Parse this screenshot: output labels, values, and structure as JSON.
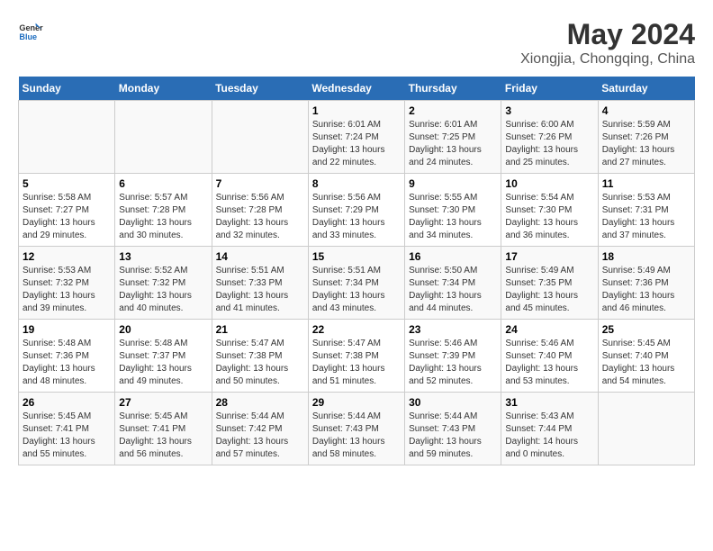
{
  "header": {
    "logo_line1": "General",
    "logo_line2": "Blue",
    "main_title": "May 2024",
    "subtitle": "Xiongjia, Chongqing, China"
  },
  "weekdays": [
    "Sunday",
    "Monday",
    "Tuesday",
    "Wednesday",
    "Thursday",
    "Friday",
    "Saturday"
  ],
  "weeks": [
    [
      {
        "day": "",
        "info": ""
      },
      {
        "day": "",
        "info": ""
      },
      {
        "day": "",
        "info": ""
      },
      {
        "day": "1",
        "info": "Sunrise: 6:01 AM\nSunset: 7:24 PM\nDaylight: 13 hours\nand 22 minutes."
      },
      {
        "day": "2",
        "info": "Sunrise: 6:01 AM\nSunset: 7:25 PM\nDaylight: 13 hours\nand 24 minutes."
      },
      {
        "day": "3",
        "info": "Sunrise: 6:00 AM\nSunset: 7:26 PM\nDaylight: 13 hours\nand 25 minutes."
      },
      {
        "day": "4",
        "info": "Sunrise: 5:59 AM\nSunset: 7:26 PM\nDaylight: 13 hours\nand 27 minutes."
      }
    ],
    [
      {
        "day": "5",
        "info": "Sunrise: 5:58 AM\nSunset: 7:27 PM\nDaylight: 13 hours\nand 29 minutes."
      },
      {
        "day": "6",
        "info": "Sunrise: 5:57 AM\nSunset: 7:28 PM\nDaylight: 13 hours\nand 30 minutes."
      },
      {
        "day": "7",
        "info": "Sunrise: 5:56 AM\nSunset: 7:28 PM\nDaylight: 13 hours\nand 32 minutes."
      },
      {
        "day": "8",
        "info": "Sunrise: 5:56 AM\nSunset: 7:29 PM\nDaylight: 13 hours\nand 33 minutes."
      },
      {
        "day": "9",
        "info": "Sunrise: 5:55 AM\nSunset: 7:30 PM\nDaylight: 13 hours\nand 34 minutes."
      },
      {
        "day": "10",
        "info": "Sunrise: 5:54 AM\nSunset: 7:30 PM\nDaylight: 13 hours\nand 36 minutes."
      },
      {
        "day": "11",
        "info": "Sunrise: 5:53 AM\nSunset: 7:31 PM\nDaylight: 13 hours\nand 37 minutes."
      }
    ],
    [
      {
        "day": "12",
        "info": "Sunrise: 5:53 AM\nSunset: 7:32 PM\nDaylight: 13 hours\nand 39 minutes."
      },
      {
        "day": "13",
        "info": "Sunrise: 5:52 AM\nSunset: 7:32 PM\nDaylight: 13 hours\nand 40 minutes."
      },
      {
        "day": "14",
        "info": "Sunrise: 5:51 AM\nSunset: 7:33 PM\nDaylight: 13 hours\nand 41 minutes."
      },
      {
        "day": "15",
        "info": "Sunrise: 5:51 AM\nSunset: 7:34 PM\nDaylight: 13 hours\nand 43 minutes."
      },
      {
        "day": "16",
        "info": "Sunrise: 5:50 AM\nSunset: 7:34 PM\nDaylight: 13 hours\nand 44 minutes."
      },
      {
        "day": "17",
        "info": "Sunrise: 5:49 AM\nSunset: 7:35 PM\nDaylight: 13 hours\nand 45 minutes."
      },
      {
        "day": "18",
        "info": "Sunrise: 5:49 AM\nSunset: 7:36 PM\nDaylight: 13 hours\nand 46 minutes."
      }
    ],
    [
      {
        "day": "19",
        "info": "Sunrise: 5:48 AM\nSunset: 7:36 PM\nDaylight: 13 hours\nand 48 minutes."
      },
      {
        "day": "20",
        "info": "Sunrise: 5:48 AM\nSunset: 7:37 PM\nDaylight: 13 hours\nand 49 minutes."
      },
      {
        "day": "21",
        "info": "Sunrise: 5:47 AM\nSunset: 7:38 PM\nDaylight: 13 hours\nand 50 minutes."
      },
      {
        "day": "22",
        "info": "Sunrise: 5:47 AM\nSunset: 7:38 PM\nDaylight: 13 hours\nand 51 minutes."
      },
      {
        "day": "23",
        "info": "Sunrise: 5:46 AM\nSunset: 7:39 PM\nDaylight: 13 hours\nand 52 minutes."
      },
      {
        "day": "24",
        "info": "Sunrise: 5:46 AM\nSunset: 7:40 PM\nDaylight: 13 hours\nand 53 minutes."
      },
      {
        "day": "25",
        "info": "Sunrise: 5:45 AM\nSunset: 7:40 PM\nDaylight: 13 hours\nand 54 minutes."
      }
    ],
    [
      {
        "day": "26",
        "info": "Sunrise: 5:45 AM\nSunset: 7:41 PM\nDaylight: 13 hours\nand 55 minutes."
      },
      {
        "day": "27",
        "info": "Sunrise: 5:45 AM\nSunset: 7:41 PM\nDaylight: 13 hours\nand 56 minutes."
      },
      {
        "day": "28",
        "info": "Sunrise: 5:44 AM\nSunset: 7:42 PM\nDaylight: 13 hours\nand 57 minutes."
      },
      {
        "day": "29",
        "info": "Sunrise: 5:44 AM\nSunset: 7:43 PM\nDaylight: 13 hours\nand 58 minutes."
      },
      {
        "day": "30",
        "info": "Sunrise: 5:44 AM\nSunset: 7:43 PM\nDaylight: 13 hours\nand 59 minutes."
      },
      {
        "day": "31",
        "info": "Sunrise: 5:43 AM\nSunset: 7:44 PM\nDaylight: 14 hours\nand 0 minutes."
      },
      {
        "day": "",
        "info": ""
      }
    ]
  ]
}
